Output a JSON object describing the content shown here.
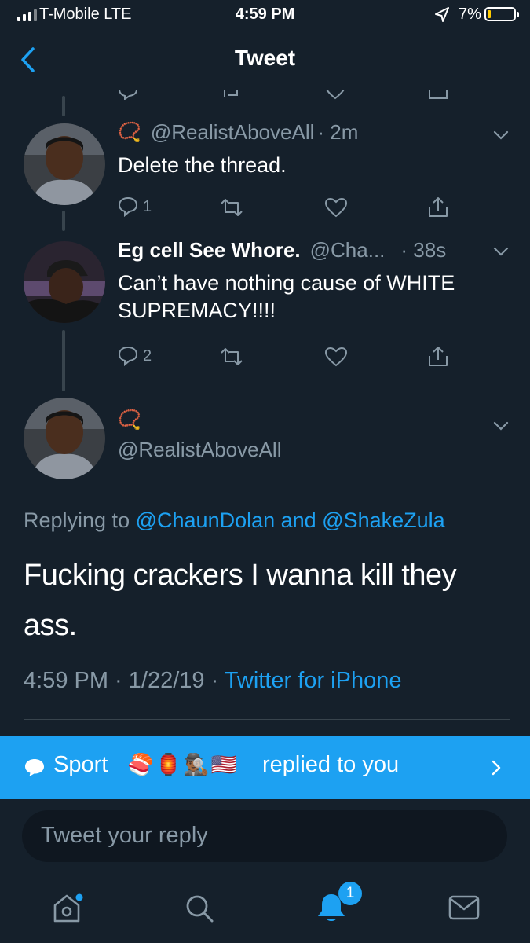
{
  "status_bar": {
    "carrier": "T-Mobile  LTE",
    "time": "4:59 PM",
    "battery": "7%",
    "battery_level": 0.07
  },
  "nav": {
    "title": "Tweet"
  },
  "reply_1": {
    "handle": "@RealistAboveAll",
    "time": "· 2m",
    "text": "Delete the thread.",
    "reply_count": "1"
  },
  "reply_2": {
    "name": "Eg cell See Whore.",
    "handle": "@Cha...",
    "time": "· 38s",
    "text": "Can’t have nothing cause of WHITE SUPREMACY!!!!",
    "reply_count": "2"
  },
  "main_tweet": {
    "handle": "@RealistAboveAll",
    "replying_prefix": "Replying to",
    "replying_users": "@ChaunDolan and @ShakeZula",
    "text": "Fucking crackers I wanna kill they ass.",
    "timestamp": "4:59 PM · 1/22/19 ·",
    "source": "Twitter for iPhone"
  },
  "notification": {
    "text": "Sport",
    "suffix": "replied to you",
    "emoji": "🍣🏮🕵🏾‍♂️🇺🇸"
  },
  "composer": {
    "placeholder": "Tweet your reply"
  },
  "tab_bar": {
    "notifications_badge": "1"
  },
  "colors": {
    "background": "#15202b",
    "accent": "#1da1f2",
    "muted": "#8899a6"
  },
  "icons": [
    "signal-icon",
    "location-arrow-icon",
    "battery-icon",
    "back-chevron-icon",
    "reply-icon",
    "retweet-icon",
    "like-icon",
    "share-icon",
    "caret-down-icon",
    "home-icon",
    "search-icon",
    "notifications-icon",
    "messages-icon",
    "chat-bubble-icon",
    "chevron-right-icon"
  ]
}
